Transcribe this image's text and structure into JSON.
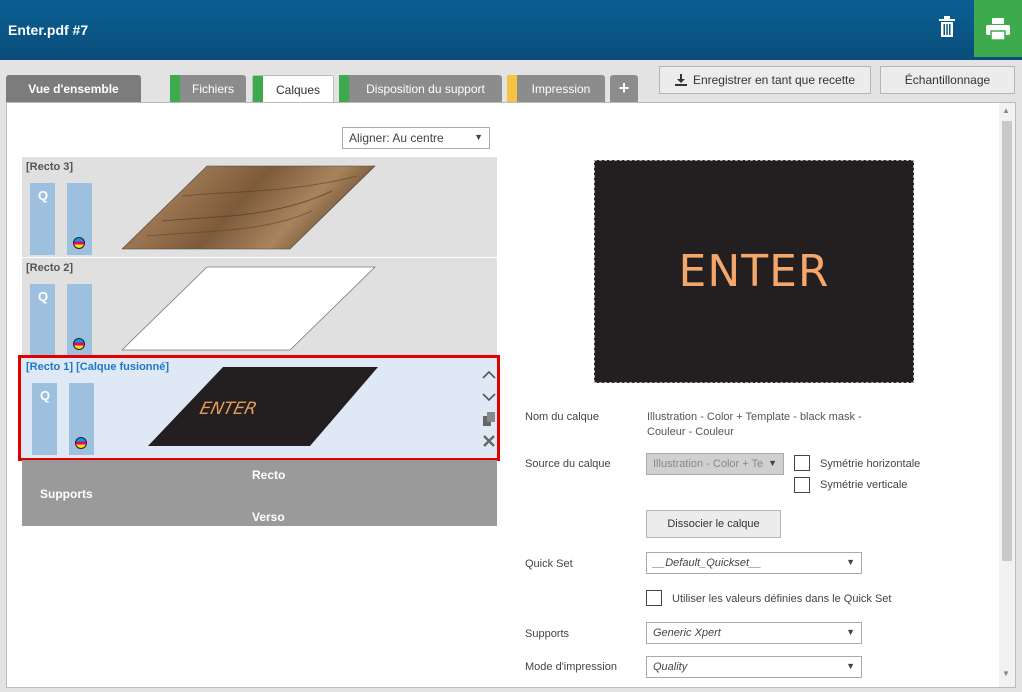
{
  "header": {
    "title": "Enter.pdf #7",
    "delete_icon": "trash-icon",
    "print_icon": "printer-icon"
  },
  "tabs": [
    {
      "label": "Vue d'ensemble"
    },
    {
      "label": "Fichiers",
      "stripe": "#3daa4e"
    },
    {
      "label": "Calques",
      "stripe": "#3daa4e",
      "active": true
    },
    {
      "label": "Disposition du support",
      "stripe": "#3daa4e"
    },
    {
      "label": "Impression",
      "stripe": "#f5c242"
    }
  ],
  "add_tab_label": "+",
  "toolbar": {
    "save_recipe_label": "Enregistrer en tant que recette",
    "sampling_label": "Échantillonnage"
  },
  "align": {
    "value": "Aligner: Au centre"
  },
  "layers": [
    {
      "label": "[Recto 3]",
      "q": "Q",
      "thumb": "wood"
    },
    {
      "label": "[Recto 2]",
      "q": "Q",
      "thumb": "white"
    },
    {
      "label": "[Recto 1] [Calque fusionné]",
      "q": "Q",
      "thumb": "enter",
      "thumb_text": "ENTER",
      "selected": true
    }
  ],
  "supports": {
    "recto": "Recto",
    "label": "Supports",
    "verso": "Verso"
  },
  "preview": {
    "text": "ENTER"
  },
  "properties": {
    "layer_name_label": "Nom du calque",
    "layer_name_value_1": "Illustration - Color + Template - black mask -",
    "layer_name_value_2": "Couleur - Couleur",
    "layer_source_label": "Source du calque",
    "layer_source_value": "Illustration - Color + Te",
    "flip_h_label": "Symétrie horizontale",
    "flip_v_label": "Symétrie verticale",
    "dissociate_label": "Dissocier le calque",
    "quickset_label": "Quick Set",
    "quickset_value": "__Default_Quickset__",
    "use_quickset_label": "Utiliser les valeurs définies dans le Quick Set",
    "supports_label": "Supports",
    "supports_value": "Generic Xpert",
    "print_mode_label": "Mode d'impression",
    "print_mode_value": "Quality"
  }
}
